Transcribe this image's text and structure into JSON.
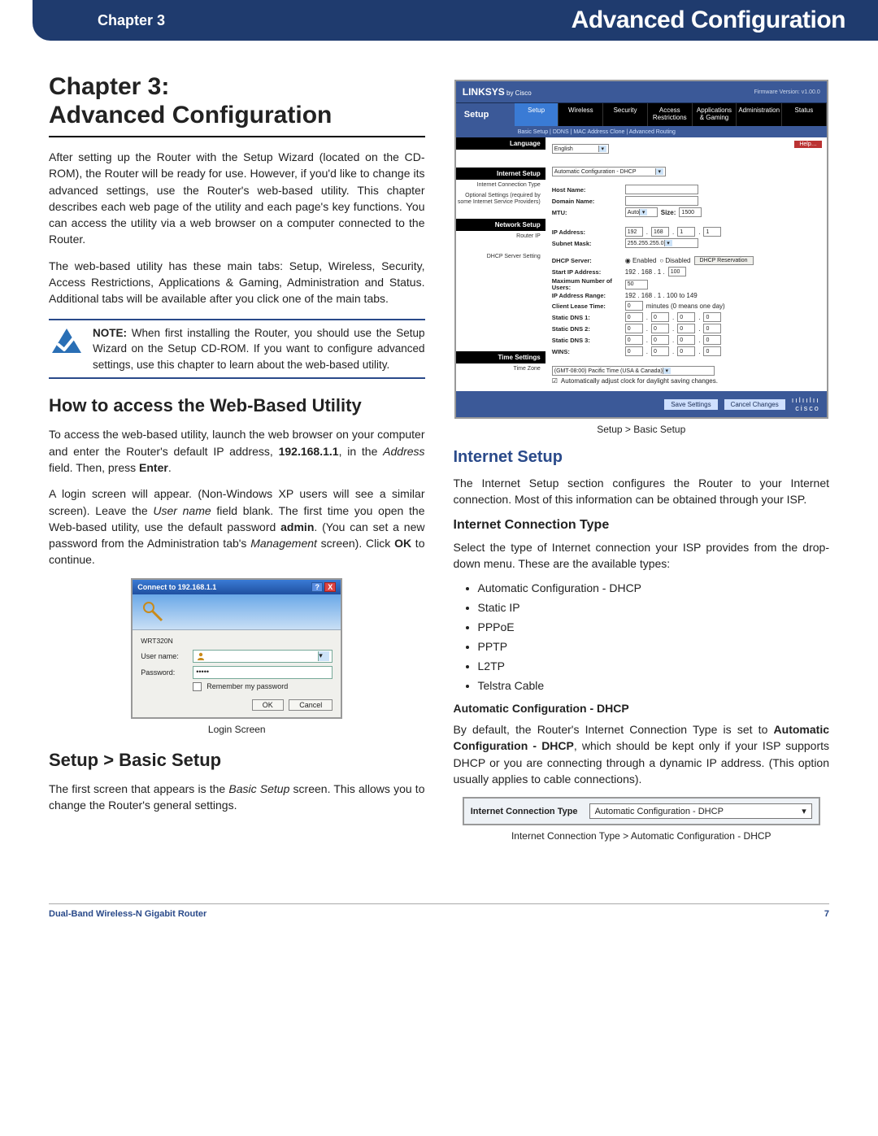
{
  "header": {
    "left": "Chapter 3",
    "right": "Advanced Configuration"
  },
  "title_line1": "Chapter 3:",
  "title_line2": "Advanced Configuration",
  "intro_p1": "After setting up the Router with the Setup Wizard (located on the CD-ROM), the Router will be ready for use. However, if you'd like to change its advanced settings, use the Router's web-based utility. This chapter describes each web page of the utility and each page's key functions. You can access the utility via a web browser on a computer connected to the Router.",
  "intro_p2": "The web-based utility has these main tabs: Setup, Wireless, Security, Access Restrictions, Applications & Gaming, Administration and Status. Additional tabs will be available after you click one of the main tabs.",
  "note": {
    "label": "NOTE:",
    "text": " When first installing the Router, you should use the Setup Wizard on the Setup CD-ROM. If you want to configure advanced settings, use this chapter to learn about the web-based utility."
  },
  "h2_access": "How to access the Web-Based Utility",
  "access_p1_a": "To access the web-based utility, launch the web browser on your computer and enter the Router's default IP address, ",
  "access_p1_ip": "192.168.1.1",
  "access_p1_b": ", in the ",
  "access_p1_addr": "Address",
  "access_p1_c": " field. Then, press ",
  "access_p1_enter": "Enter",
  "access_p1_d": ".",
  "access_p2_a": "A login screen will appear. (Non-Windows XP users will see a similar screen). Leave the ",
  "access_p2_user": "User name",
  "access_p2_b": " field blank. The first time you open the Web-based utility, use the default password ",
  "access_p2_admin": "admin",
  "access_p2_c": ". (You can set a new password from the Administration tab's ",
  "access_p2_mgmt": "Management",
  "access_p2_d": " screen). Click ",
  "access_p2_ok": "OK",
  "access_p2_e": " to continue.",
  "login": {
    "title": "Connect to 192.168.1.1",
    "realm": "WRT320N",
    "user_label": "User name:",
    "pass_label": "Password:",
    "pass_value": "•••••",
    "remember": "Remember my password",
    "ok": "OK",
    "cancel": "Cancel",
    "caption": "Login Screen"
  },
  "h2_basic": "Setup > Basic Setup",
  "basic_p1_a": "The first screen that appears is the ",
  "basic_p1_i": "Basic Setup",
  "basic_p1_b": " screen. This allows you to change the Router's general settings.",
  "router": {
    "brand": "LINKSYS",
    "by": "by Cisco",
    "fw": "Firmware Version: v1.00.0",
    "setup": "Setup",
    "tabs": [
      "Setup",
      "Wireless",
      "Security",
      "Access Restrictions",
      "Applications & Gaming",
      "Administration",
      "Status"
    ],
    "subtabs": "Basic Setup   |   DDNS   |   MAC Address Clone   |   Advanced Routing",
    "left_lang": "Language",
    "lang_value": "English",
    "help": "Help…",
    "left_isetup": "Internet Setup",
    "l_ict": "Internet Connection Type",
    "ict_value": "Automatic Configuration - DHCP",
    "l_opt": "Optional Settings (required by some Internet Service Providers)",
    "k_host": "Host Name:",
    "k_domain": "Domain Name:",
    "k_mtu": "MTU:",
    "mtu_mode": "Auto",
    "mtu_size_lbl": "Size:",
    "mtu_size": "1500",
    "left_net": "Network Setup",
    "l_router": "Router IP",
    "k_ip": "IP Address:",
    "ip1": "192",
    "ip2": "168",
    "ip3": "1",
    "ip4": "1",
    "k_subnet": "Subnet Mask:",
    "subnet": "255.255.255.0",
    "l_dhcp": "DHCP Server Setting",
    "k_dhcp": "DHCP Server:",
    "dhcp_en": "Enabled",
    "dhcp_dis": "Disabled",
    "dhcp_res": "DHCP Reservation",
    "k_start": "Start IP Address:",
    "start_pre": "192 . 168 . 1 .",
    "start_v": "100",
    "k_max": "Maximum Number of Users:",
    "max_v": "50",
    "k_range": "IP Address Range:",
    "range_v": "192 . 168 . 1 . 100 to 149",
    "k_lease": "Client Lease Time:",
    "lease_v": "0",
    "lease_unit": "minutes (0 means one day)",
    "k_dns1": "Static DNS 1:",
    "k_dns2": "Static DNS 2:",
    "k_dns3": "Static DNS 3:",
    "k_wins": "WINS:",
    "zero": "0",
    "left_time": "Time Settings",
    "l_tz": "Time Zone",
    "tz": "(GMT-08:00) Pacific Time (USA & Canada)",
    "auto_dst": "Automatically adjust clock for daylight saving changes.",
    "save": "Save Settings",
    "cancel": "Cancel Changes",
    "cisco": "cisco",
    "caption": "Setup > Basic Setup"
  },
  "h3_internet": "Internet Setup",
  "internet_p": "The Internet Setup section configures the Router to your Internet connection. Most of this information can be obtained through your ISP.",
  "h4_ict": "Internet Connection Type",
  "ict_p": "Select the type of Internet connection your ISP provides from the drop-down menu. These are the available types:",
  "ict_list": [
    "Automatic Configuration - DHCP",
    "Static IP",
    "PPPoE",
    "PPTP",
    "L2TP",
    "Telstra Cable"
  ],
  "h5_auto": "Automatic Configuration - DHCP",
  "auto_p_a": "By default, the Router's Internet Connection Type is set to ",
  "auto_p_b": "Automatic Configuration - DHCP",
  "auto_p_c": ", which should be kept only if your ISP supports DHCP or you are connecting through a dynamic IP address. (This option usually applies to cable connections).",
  "ict_bar": {
    "label": "Internet Connection Type",
    "value": "Automatic Configuration - DHCP",
    "caption": "Internet Connection Type > Automatic Configuration - DHCP"
  },
  "footer": {
    "left": "Dual-Band Wireless-N Gigabit Router",
    "right": "7"
  }
}
